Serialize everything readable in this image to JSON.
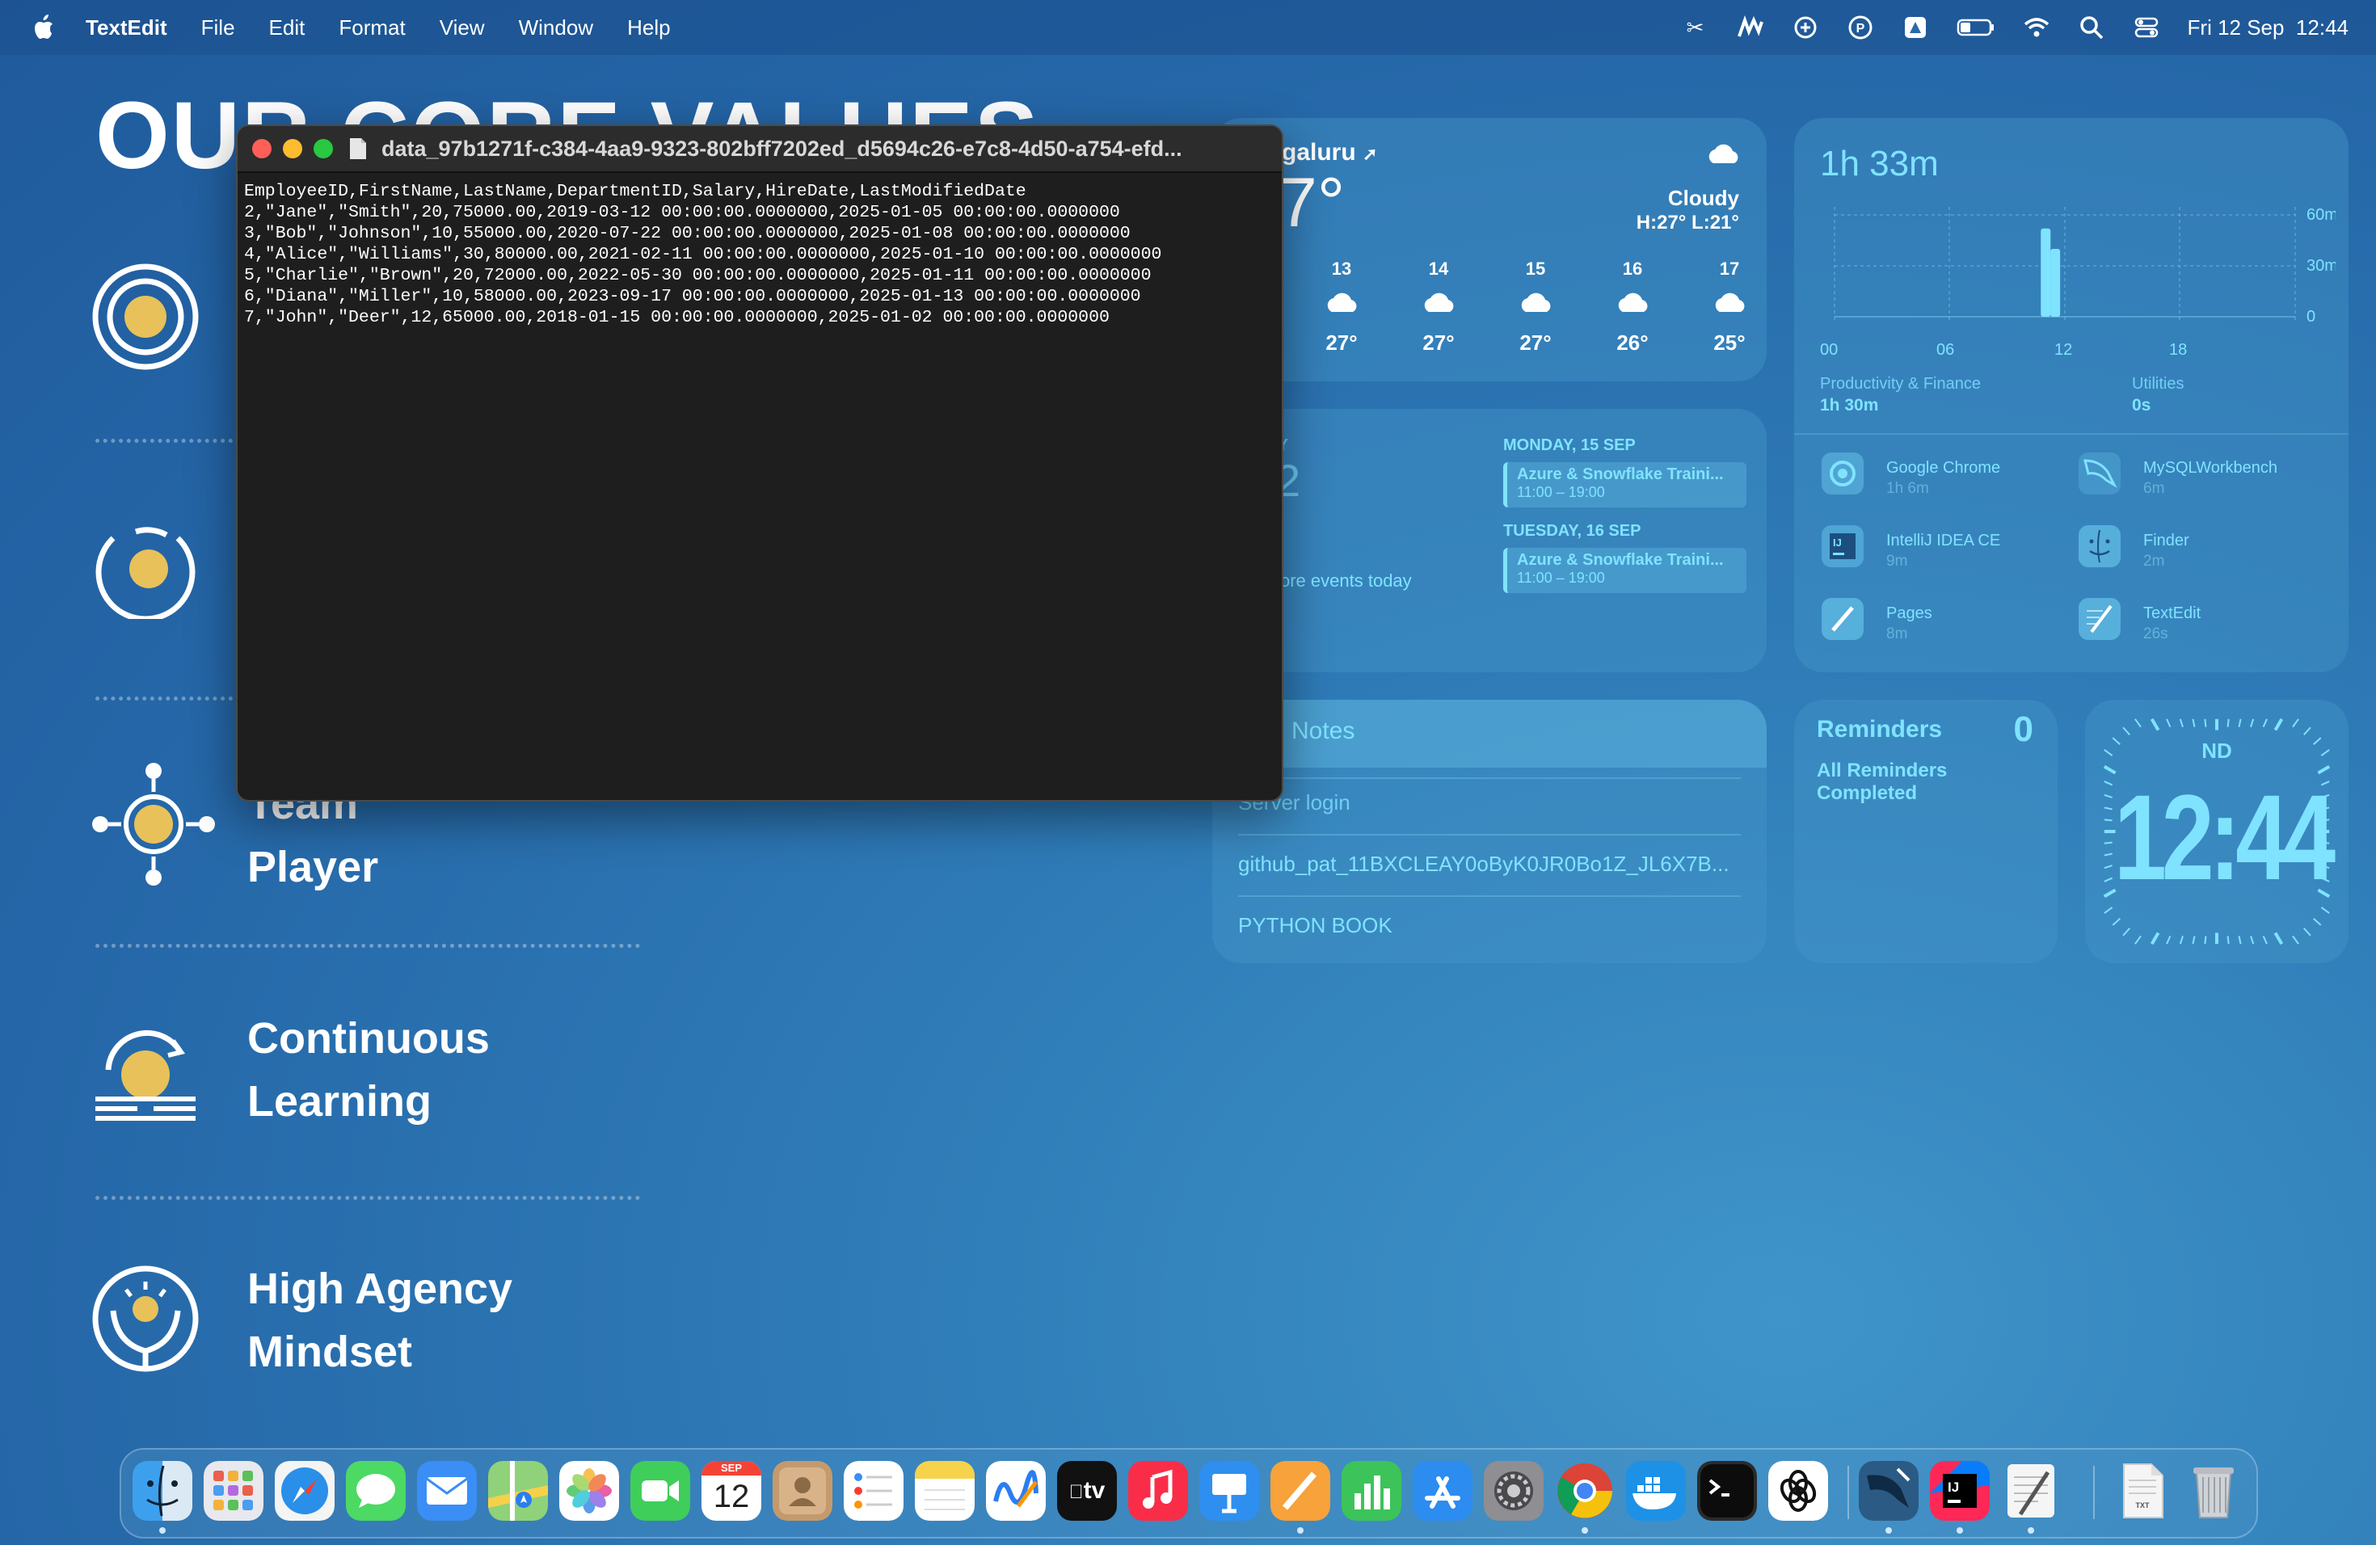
{
  "menubar": {
    "app_name": "TextEdit",
    "menus": [
      "File",
      "Edit",
      "Format",
      "View",
      "Window",
      "Help"
    ],
    "datetime": "Fri 12 Sep  12:44"
  },
  "wallpaper": {
    "title": "OUR CORE VALUES",
    "values": [
      {
        "line1": "Team",
        "line2": "Player"
      },
      {
        "line1": "Continuous",
        "line2": "Learning"
      },
      {
        "line1": "High Agency",
        "line2": "Mindset"
      }
    ]
  },
  "textedit": {
    "title": "data_97b1271f-c384-4aa9-9323-802bff7202ed_d5694c26-e7c8-4d50-a754-efd...",
    "content": "EmployeeID,FirstName,LastName,DepartmentID,Salary,HireDate,LastModifiedDate\n2,\"Jane\",\"Smith\",20,75000.00,2019-03-12 00:00:00.0000000,2025-01-05 00:00:00.0000000\n3,\"Bob\",\"Johnson\",10,55000.00,2020-07-22 00:00:00.0000000,2025-01-08 00:00:00.0000000\n4,\"Alice\",\"Williams\",30,80000.00,2021-02-11 00:00:00.0000000,2025-01-10 00:00:00.0000000\n5,\"Charlie\",\"Brown\",20,72000.00,2022-05-30 00:00:00.0000000,2025-01-11 00:00:00.0000000\n6,\"Diana\",\"Miller\",10,58000.00,2023-09-17 00:00:00.0000000,2025-01-13 00:00:00.0000000\n7,\"John\",\"Deer\",12,65000.00,2018-01-15 00:00:00.0000000,2025-01-02 00:00:00.0000000"
  },
  "weather": {
    "location": "galuru",
    "temp": "7°",
    "condition": "Cloudy",
    "hilo": "H:27° L:21°",
    "forecast": [
      {
        "hour": "13",
        "temp": "27°"
      },
      {
        "hour": "14",
        "temp": "27°"
      },
      {
        "hour": "15",
        "temp": "27°"
      },
      {
        "hour": "16",
        "temp": "26°"
      },
      {
        "hour": "17",
        "temp": "25°"
      }
    ]
  },
  "screentime": {
    "total": "1h 33m",
    "y_labels": [
      "60m",
      "30m",
      "0"
    ],
    "x_labels": [
      "00",
      "06",
      "12",
      "18"
    ],
    "chart_data": {
      "type": "bar",
      "x": [
        "11:00",
        "11:30"
      ],
      "values": [
        52,
        40
      ],
      "ylim": [
        0,
        60
      ]
    },
    "categories": [
      {
        "name": "Productivity & Finance",
        "time": "1h 30m"
      },
      {
        "name": "Utilities",
        "time": "0s"
      }
    ]
  },
  "apps_usage": [
    {
      "name": "Google Chrome",
      "time": "1h 6m"
    },
    {
      "name": "MySQLWorkbench",
      "time": "6m"
    },
    {
      "name": "IntelliJ IDEA CE",
      "time": "9m"
    },
    {
      "name": "Finder",
      "time": "2m"
    },
    {
      "name": "Pages",
      "time": "8m"
    },
    {
      "name": "TextEdit",
      "time": "26s"
    }
  ],
  "calendar": {
    "today_label": "AY",
    "today_num": "2",
    "more_events": "ore events today",
    "days": [
      {
        "header": "MONDAY, 15 SEP",
        "event": "Azure & Snowflake Traini...",
        "time": "11:00 – 19:00"
      },
      {
        "header": "TUESDAY, 16 SEP",
        "event": "Azure & Snowflake Traini...",
        "time": "11:00 – 19:00"
      }
    ]
  },
  "notes": {
    "title": "Notes",
    "items": [
      "Server login",
      "github_pat_11BXCLEAY0oByK0JR0Bo1Z_JL6X7B...",
      "PYTHON BOOK"
    ]
  },
  "reminders": {
    "title": "Reminders",
    "count": "0",
    "status_line1": "All Reminders",
    "status_line2": "Completed"
  },
  "clock": {
    "day": "ND",
    "time": "12:44"
  },
  "dock": {
    "calendar_month": "SEP",
    "calendar_day": "12",
    "tv_label": "tv",
    "file_label": "TXT"
  },
  "colors": {
    "accent": "#7fe3ff",
    "window_bg": "#1e1e1e",
    "traffic_red": "#ff5f57",
    "traffic_yellow": "#febc2e",
    "traffic_green": "#28c840",
    "sun_yellow": "#e8c15a"
  }
}
